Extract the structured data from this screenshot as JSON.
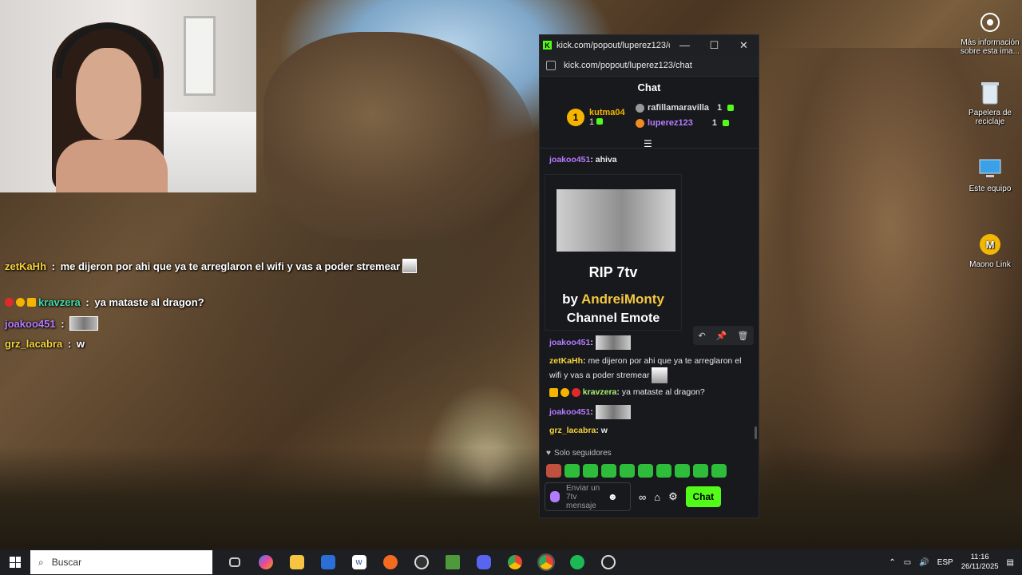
{
  "overlay_chat": [
    {
      "user": "zetKaHh",
      "sep": " : ",
      "text": "me dijeron por ahi que ya te arreglaron el wifi y vas a poder stremear"
    },
    {
      "user": "kravzera",
      "sep": " : ",
      "text": "ya mataste al dragon?"
    },
    {
      "user": "joakoo451",
      "sep": " : ",
      "text": ""
    },
    {
      "user": "grz_lacabra",
      "sep": " : ",
      "text": "w"
    }
  ],
  "desktop_icons": [
    {
      "label": "Más información sobre esta ima..."
    },
    {
      "label": "Papelera de reciclaje"
    },
    {
      "label": "Este equipo"
    },
    {
      "label": "Maono Link"
    }
  ],
  "browser": {
    "title": "kick.com/popout/luperez123/ch...",
    "url": "kick.com/popout/luperez123/chat",
    "minimize": "—",
    "maximize": "☐",
    "close": "✕"
  },
  "chat": {
    "header": "Chat",
    "top_gifter": {
      "rank": "1",
      "name": "kutma04",
      "count": "1"
    },
    "gifters": [
      {
        "name": "rafillamaravilla",
        "count": "1"
      },
      {
        "name": "luperez123",
        "count": "1"
      }
    ],
    "messages": [
      {
        "user": "joakoo451",
        "sep": ": ",
        "text": "ahiva"
      },
      {
        "user": "joakoo451",
        "sep": ": ",
        "text": ""
      },
      {
        "user": "zetKaHh",
        "sep": ": ",
        "text": "me dijeron por ahi que ya te arreglaron el wifi y vas a poder stremear"
      },
      {
        "user": "kravzera",
        "sep": ": ",
        "text": "ya mataste al dragon?"
      },
      {
        "user": "joakoo451",
        "sep": ": ",
        "text": ""
      },
      {
        "user": "grz_lacabra",
        "sep": ": ",
        "text": "w"
      }
    ],
    "emote_card": {
      "title": "RIP 7tv",
      "by_prefix": "by ",
      "author": "AndreiMonty",
      "type": "Channel Emote"
    },
    "followers_only": "Solo seguidores",
    "input_placeholder": "Enviar un 7tv mensaje",
    "send_button": "Chat"
  },
  "taskbar": {
    "search_placeholder": "Buscar",
    "language": "ESP",
    "time": "11:16",
    "date": "26/11/2025"
  }
}
